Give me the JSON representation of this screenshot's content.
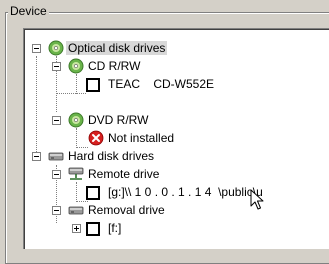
{
  "group": {
    "label": "Device"
  },
  "tree": {
    "optical": {
      "label": "Optical disk drives",
      "cdrw": {
        "label": "CD R/RW",
        "device": "TEAC    CD-W552E"
      },
      "dvdrw": {
        "label": "DVD R/RW",
        "status": "Not installed"
      }
    },
    "hard": {
      "label": "Hard disk drives",
      "remote": {
        "label": "Remote drive",
        "path": "[g:]\\\\ 1 0 . 0 . 1 . 1 4  \\public\\u"
      },
      "removal": {
        "label": "Removal drive",
        "drive": "[f:]"
      }
    }
  },
  "colors": {
    "selection": "#d8d8d8",
    "error": "#d62020",
    "disc_green": "#6ab44a"
  }
}
